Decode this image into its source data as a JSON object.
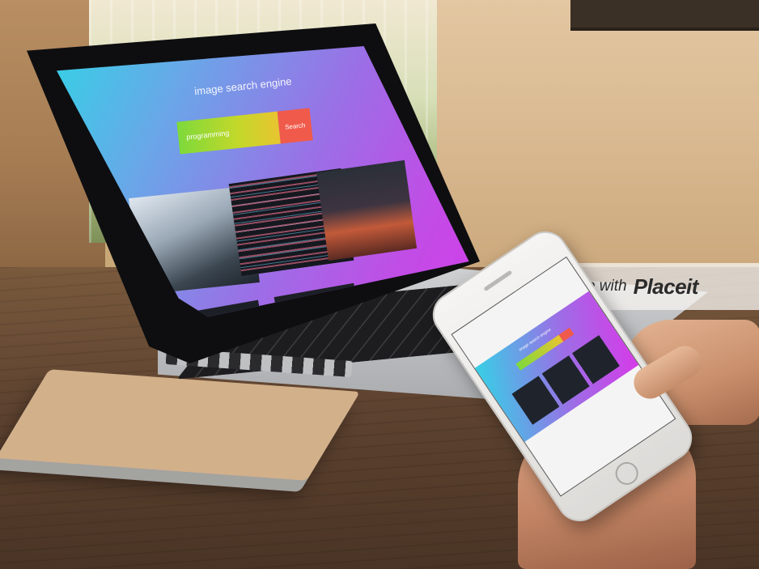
{
  "laptop_screen": {
    "title": "image search engine",
    "search": {
      "value": "programming",
      "button_label": "Search"
    },
    "thumbnails": [
      "laptop-code-desk",
      "code-editor-closeup",
      "monitor-dark-room"
    ]
  },
  "watermark": {
    "prefix": "made with",
    "brand": "Placeit"
  },
  "colors": {
    "gradient_start": "#36d0e6",
    "gradient_end": "#d63be8",
    "search_input": "#9ad83a",
    "search_button": "#f05a4a"
  },
  "icons": [
    "home-button-icon"
  ]
}
